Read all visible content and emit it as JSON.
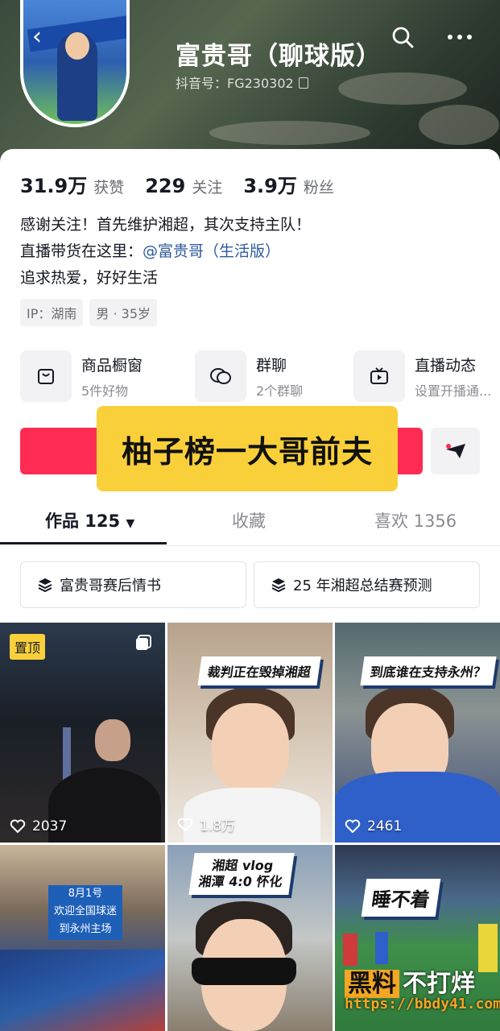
{
  "profile": {
    "nickname": "富贵哥（聊球版）",
    "douyin_id": "抖音号：FG230302"
  },
  "stats": [
    {
      "value": "31.9万",
      "label": "获赞"
    },
    {
      "value": "229",
      "label": "关注"
    },
    {
      "value": "3.9万",
      "label": "粉丝"
    }
  ],
  "bio": {
    "line1": "感谢关注！首先维护湘超，其次支持主队！",
    "line2_prefix": "直播带货在这里：",
    "line2_mention": "@富贵哥（生活版）",
    "line3": "追求热爱，好好生活"
  },
  "tags": [
    "IP：湖南",
    "男 · 35岁"
  ],
  "services": [
    {
      "title": "商品橱窗",
      "sub": "5件好物",
      "icon": "shop-bag-icon"
    },
    {
      "title": "群聊",
      "sub": "2个群聊",
      "icon": "chat-bubbles-icon"
    },
    {
      "title": "直播动态",
      "sub": "设置开播通...",
      "icon": "tv-icon"
    }
  ],
  "overlay_text": "柚子榜一大哥前夫",
  "tabs": {
    "works": "作品 125",
    "favorites": "收藏",
    "likes": "喜欢 1356"
  },
  "collections": [
    "富贵哥赛后情书",
    "25 年湘超总结赛预测"
  ],
  "videos": [
    {
      "likes": "2037",
      "pinned": "置顶"
    },
    {
      "likes": "1.8万",
      "caption": "裁判正在毁掉湘超"
    },
    {
      "likes": "2461",
      "caption": "到底谁在支持永州？"
    },
    {
      "caption_lines": [
        "8月1号",
        "欢迎全国球迷",
        "到永州主场"
      ]
    },
    {
      "caption_lines": [
        "湘超 vlog",
        "湘潭 4:0 怀化"
      ]
    },
    {
      "caption": "睡不着"
    }
  ],
  "watermark": {
    "part1": "黑料",
    "part2": "不打烊",
    "url": "https://bbdy41.com"
  },
  "colors": {
    "follow": "#fe2c55",
    "overlay": "#f9d03a",
    "mention": "#2f5a9e"
  }
}
